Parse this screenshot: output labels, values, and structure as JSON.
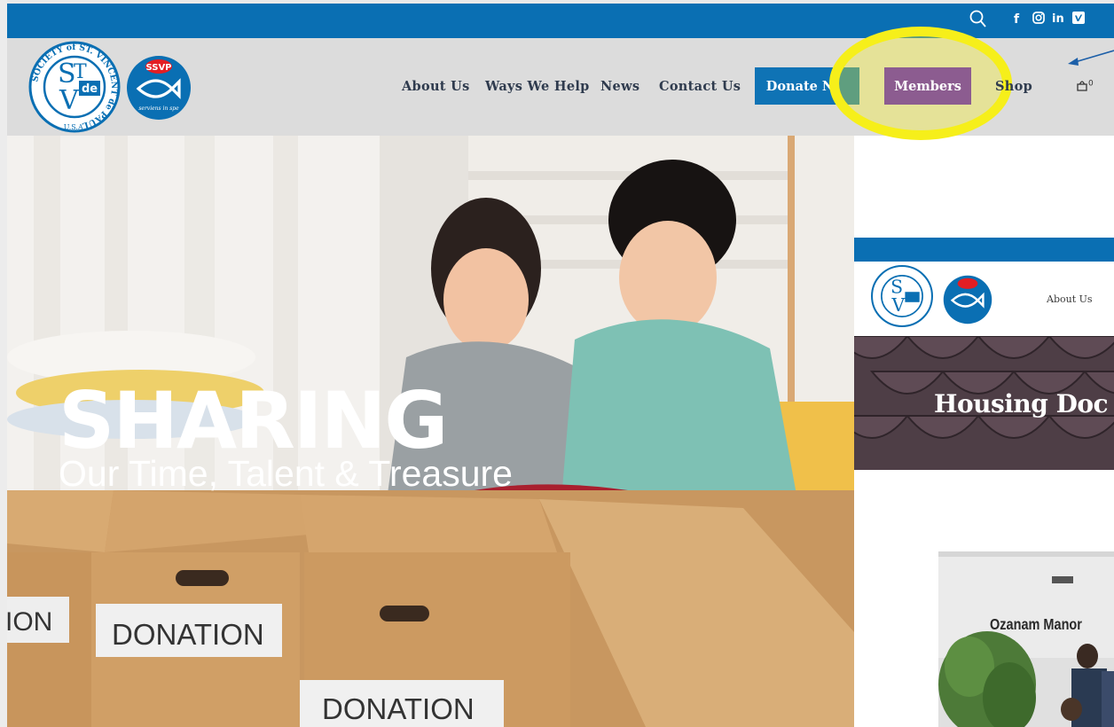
{
  "topbar": {
    "icons": [
      "search-icon",
      "facebook-icon",
      "instagram-icon",
      "linkedin-icon",
      "vimeo-icon"
    ],
    "color": "#0a6fb3"
  },
  "logos": {
    "svdp_ring_text": "SOCIETY of ST. VINCENT de PAUL",
    "svdp_monogram": "de",
    "svdp_country": "U.S.A.",
    "ssvp_label": "SSVP",
    "ssvp_tagline": "serviens in spe"
  },
  "nav": {
    "items": [
      "About Us",
      "Ways We Help",
      "News",
      "Contact Us"
    ],
    "donate_label": "Donate Now",
    "donate_visible": "Donate N",
    "members_label": "Members",
    "shop_label": "Shop",
    "cart_count": "0"
  },
  "hero": {
    "title": "SHARING",
    "subtitle": "Our Time, Talent & Treasure",
    "box_labels": [
      "ION",
      "DONATION",
      "DONATION"
    ]
  },
  "inset": {
    "nav_item": "About Us",
    "title": "Housing Doc"
  },
  "photo": {
    "sign_text": "Ozanam Manor"
  },
  "colors": {
    "brand_blue": "#0a6fb3",
    "members_purple": "#8c5c90",
    "highlight_yellow": "#f6ef1a"
  }
}
